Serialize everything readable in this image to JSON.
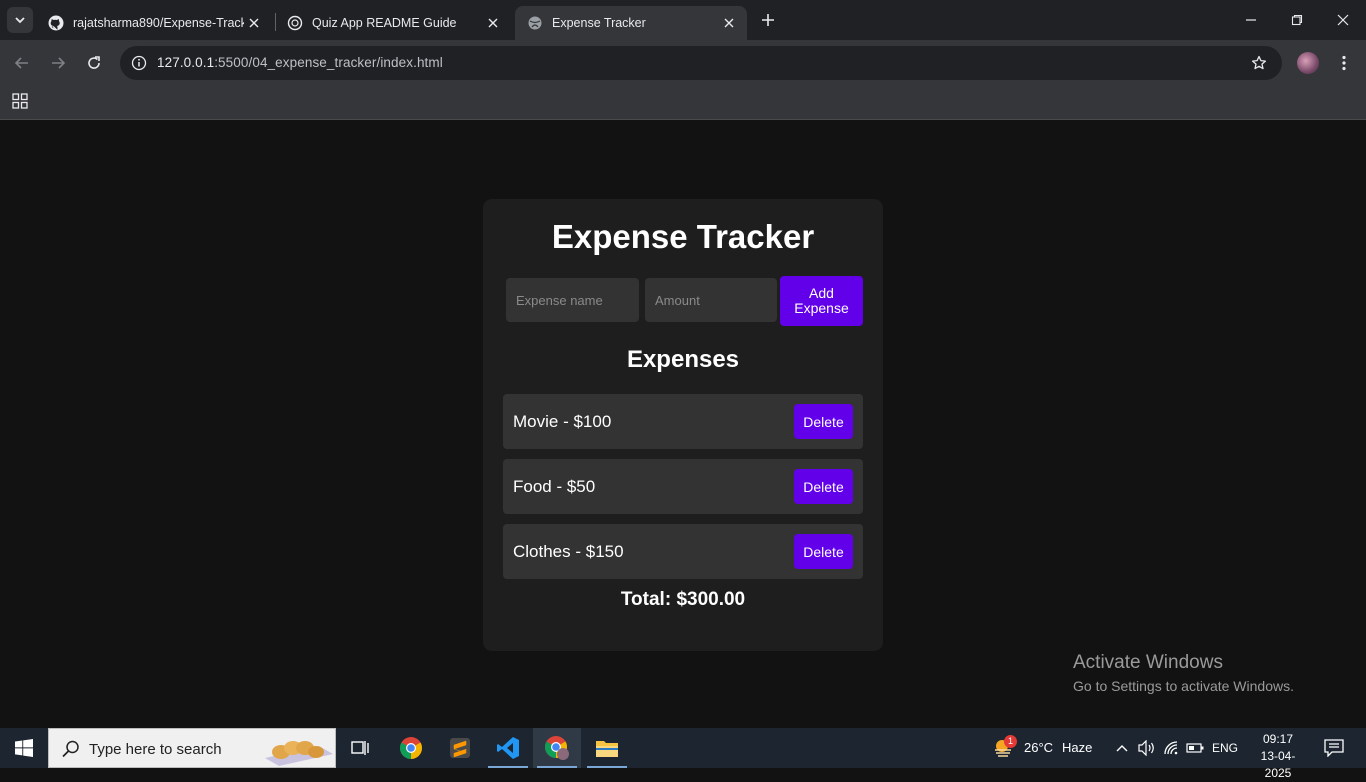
{
  "browser": {
    "tabs": [
      {
        "title": "rajatsharma890/Expense-Tracke",
        "favicon": "github-icon",
        "active": false
      },
      {
        "title": "Quiz App README Guide",
        "favicon": "chatgpt-icon",
        "active": false
      },
      {
        "title": "Expense Tracker",
        "favicon": "globe-icon",
        "active": true
      }
    ],
    "url_host": "127.0.0.1",
    "url_path": ":5500/04_expense_tracker/index.html"
  },
  "app": {
    "title": "Expense Tracker",
    "name_placeholder": "Expense name",
    "amount_placeholder": "Amount",
    "add_button": "Add Expense",
    "list_heading": "Expenses",
    "expenses": [
      {
        "label": "Movie - $100",
        "delete": "Delete"
      },
      {
        "label": "Food - $50",
        "delete": "Delete"
      },
      {
        "label": "Clothes - $150",
        "delete": "Delete"
      }
    ],
    "total": "Total: $300.00",
    "accent": "#6200ea"
  },
  "watermark": {
    "line1": "Activate Windows",
    "line2": "Go to Settings to activate Windows."
  },
  "taskbar": {
    "search_placeholder": "Type here to search",
    "weather": "26°C",
    "weather_desc": "Haze",
    "weather_badge": "1",
    "language": "ENG",
    "time": "09:17",
    "date": "13-04-2025"
  }
}
